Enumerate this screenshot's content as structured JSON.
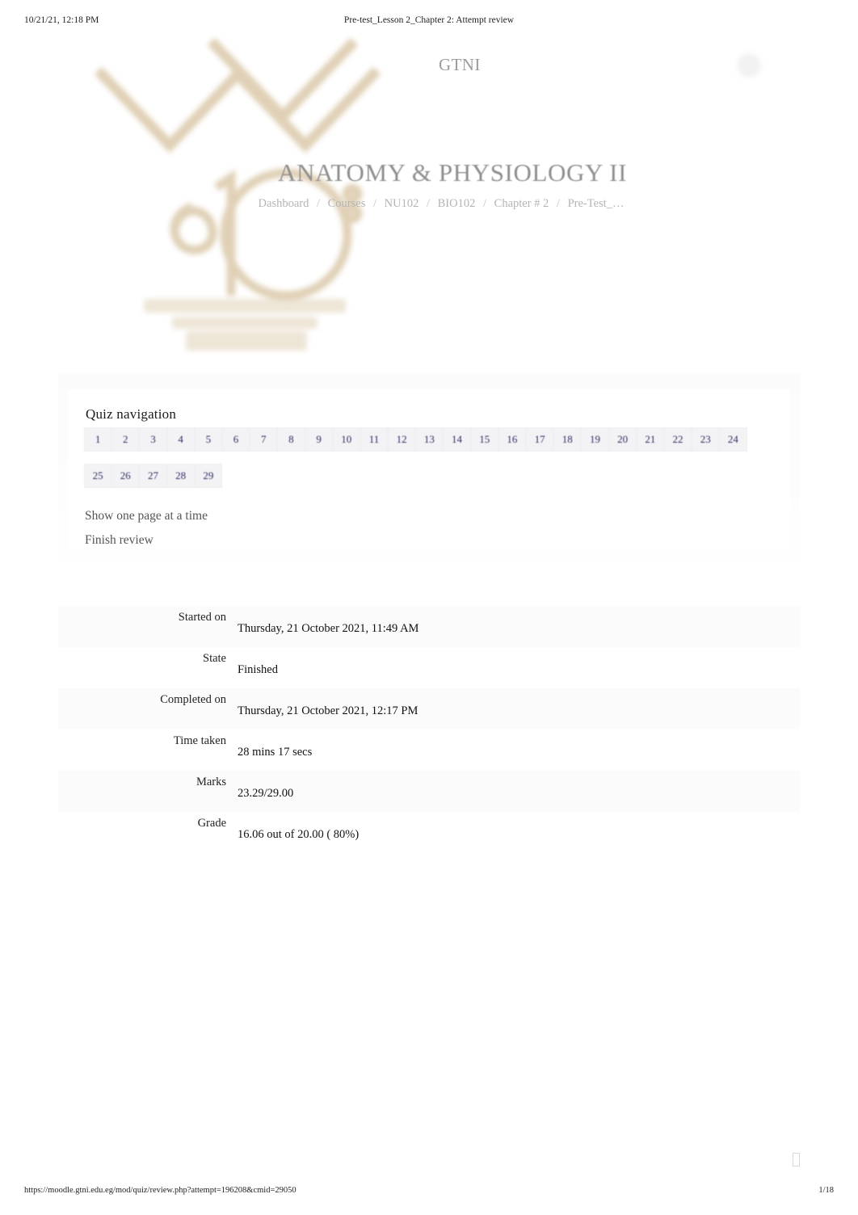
{
  "print": {
    "date": "10/21/21, 12:18 PM",
    "doc_title": "Pre-test_Lesson 2_Chapter 2: Attempt review",
    "footer_url": "https://moodle.gtni.edu.eg/mod/quiz/review.php?attempt=196208&cmid=29050",
    "page_number": "1/18"
  },
  "header": {
    "brand": "GTNI",
    "avatar_icon": "user-avatar-icon",
    "watermark_icon": "gtni-anniversary-logo"
  },
  "page": {
    "course_title": "ANATOMY & PHYSIOLOGY II",
    "breadcrumb": [
      "Dashboard",
      "Courses",
      "NU102",
      "BIO102",
      "Chapter # 2",
      "Pre-Test_…"
    ],
    "breadcrumb_separator": "/"
  },
  "quiz_navigation": {
    "title": "Quiz navigation",
    "questions": [
      "1",
      "2",
      "3",
      "4",
      "5",
      "6",
      "7",
      "8",
      "9",
      "10",
      "11",
      "12",
      "13",
      "14",
      "15",
      "16",
      "17",
      "18",
      "19",
      "20",
      "21",
      "22",
      "23",
      "24",
      "25",
      "26",
      "27",
      "28",
      "29"
    ],
    "links": [
      "Show one page at a time",
      "Finish review"
    ]
  },
  "attempt_summary": [
    {
      "label": "Started on",
      "value": "Thursday, 21 October 2021, 11:49 AM"
    },
    {
      "label": "State",
      "value": "Finished"
    },
    {
      "label": "Completed on",
      "value": "Thursday, 21 October 2021, 12:17 PM"
    },
    {
      "label": "Time taken",
      "value": "28 mins 17 secs"
    },
    {
      "label": "Marks",
      "value": "23.29/29.00"
    },
    {
      "label": "Grade",
      "value": "16.06  out of 20.00 ( 80%)"
    }
  ],
  "colors": {
    "question_number": "#302f63",
    "title_gray": "#8f8f8f",
    "breadcrumb_gray": "#b4b4b4",
    "logo_gold": "#cdb489"
  },
  "misc": {
    "missing_glyph": "□"
  }
}
